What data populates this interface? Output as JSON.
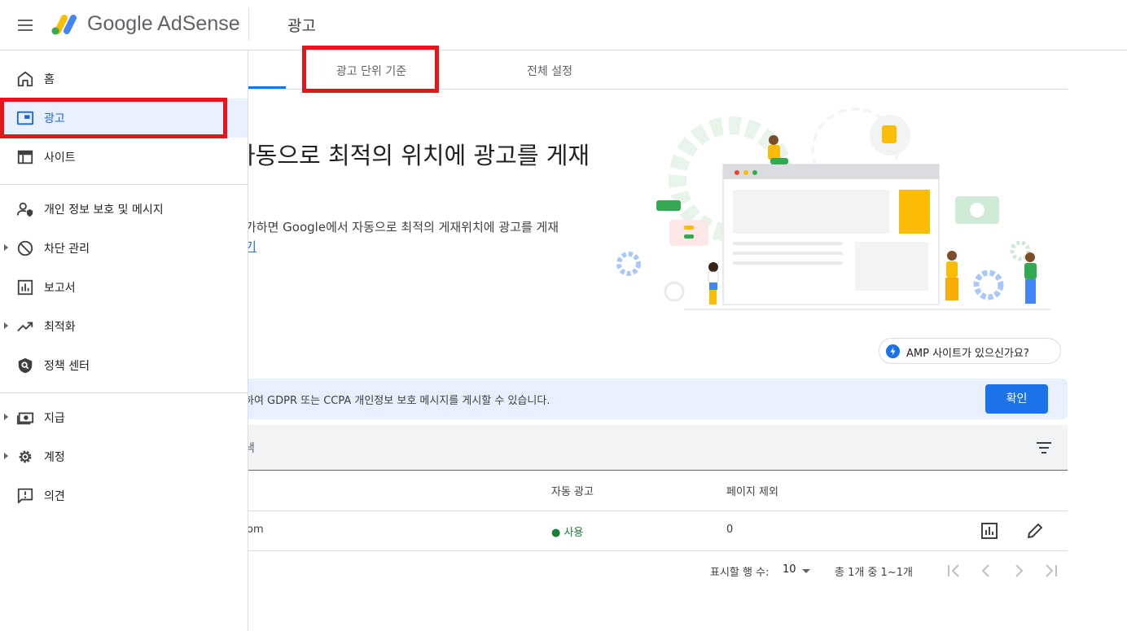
{
  "header": {
    "brand": "Google AdSense",
    "page_title": "광고"
  },
  "sidebar": {
    "items": [
      {
        "label": "홈",
        "icon": "home-icon"
      },
      {
        "label": "광고",
        "icon": "ads-icon",
        "active": true
      },
      {
        "label": "사이트",
        "icon": "sites-icon"
      },
      {
        "label": "개인 정보 보호 및 메시지",
        "icon": "privacy-icon"
      },
      {
        "label": "차단 관리",
        "icon": "block-icon",
        "expandable": true
      },
      {
        "label": "보고서",
        "icon": "report-icon"
      },
      {
        "label": "최적화",
        "icon": "trending-icon",
        "expandable": true
      },
      {
        "label": "정책 센터",
        "icon": "policy-icon"
      },
      {
        "label": "지급",
        "icon": "payments-icon",
        "expandable": true
      },
      {
        "label": "계정",
        "icon": "gear-icon",
        "expandable": true
      },
      {
        "label": "의견",
        "icon": "feedback-icon"
      }
    ]
  },
  "tabs": [
    {
      "label": "광고 단위 기준"
    },
    {
      "label": "전체 설정"
    }
  ],
  "hero": {
    "title": "자동으로 최적의 위치에 광고를 게재",
    "desc": "가하면 Google에서 자동으로 최적의 게재위치에 광고를 게재",
    "link": "기"
  },
  "amp_button": "AMP 사이트가 있으신가요?",
  "notice": {
    "text": "하여 GDPR 또는 CCPA 개인정보 보호 메시지를 게시할 수 있습니다.",
    "button": "확인"
  },
  "search": {
    "text": "색"
  },
  "table": {
    "headers": {
      "auto_ads": "자동 광고",
      "excluded_pages": "페이지 제외"
    },
    "rows": [
      {
        "site": "om",
        "auto_ads": "● 사용",
        "excluded_pages": "0"
      }
    ]
  },
  "pager": {
    "rows_label": "표시할 행 수:",
    "rows_value": "10",
    "range": "총 1개 중 1~1개"
  },
  "colors": {
    "accent": "#1a73e8",
    "active_bg": "#e8f0fe",
    "highlight": "#e8141c",
    "status_green": "#188038"
  }
}
